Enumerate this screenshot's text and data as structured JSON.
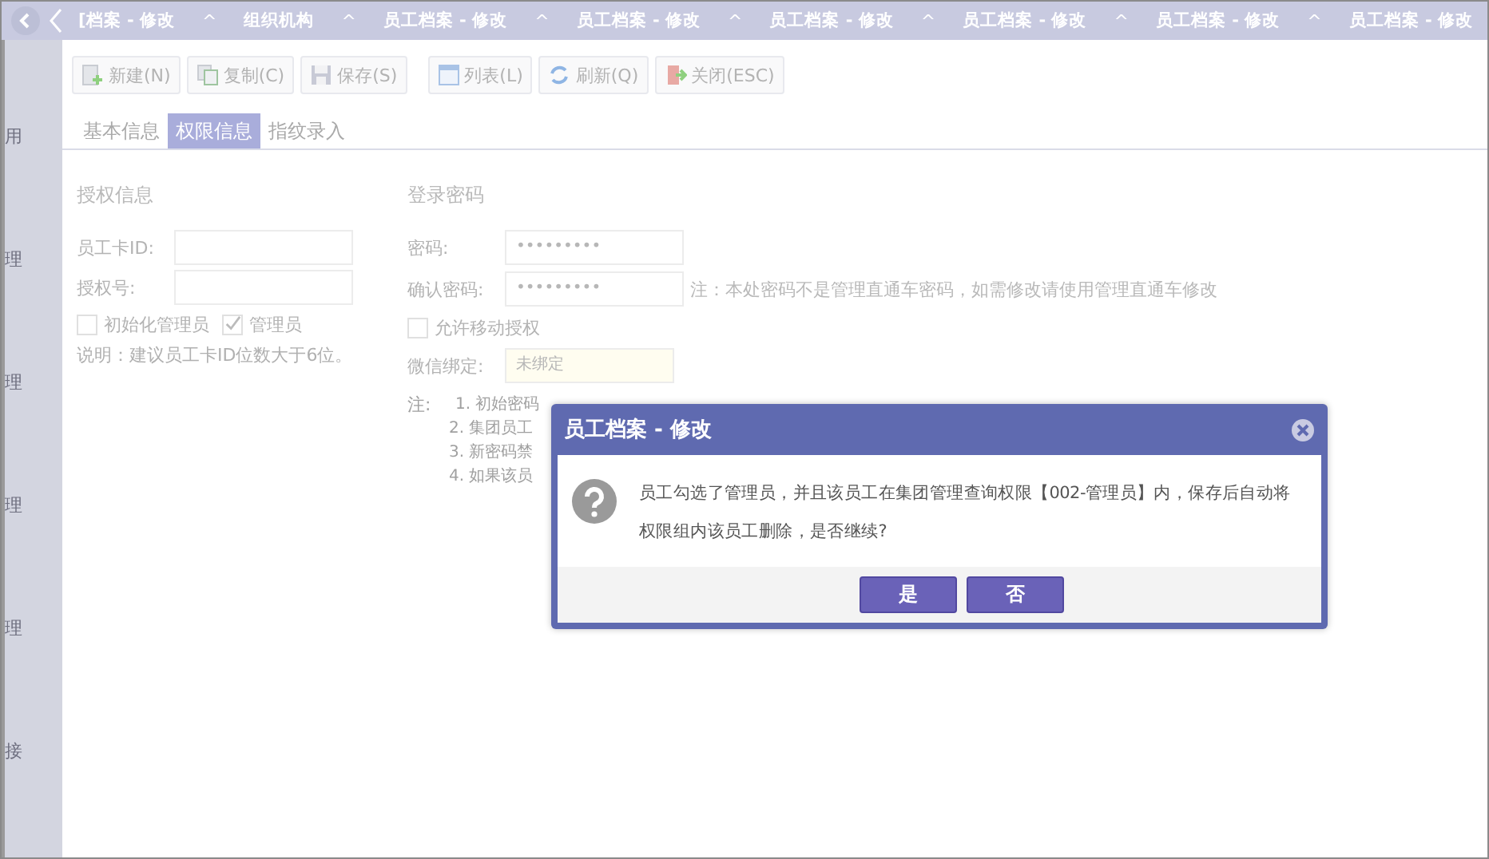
{
  "tabs": [
    {
      "label": "[档案 - 修改",
      "marker": "^"
    },
    {
      "label": "组织机构",
      "marker": "^"
    },
    {
      "label": "员工档案 - 修改",
      "marker": "^"
    },
    {
      "label": "员工档案 - 修改",
      "marker": "^"
    },
    {
      "label": "员工档案 - 修改",
      "marker": "^"
    },
    {
      "label": "员工档案 - 修改",
      "marker": "^"
    },
    {
      "label": "员工档案 - 修改",
      "marker": "^"
    },
    {
      "label": "员工档案 - 修改"
    }
  ],
  "sidebar": {
    "items": [
      "用",
      "理",
      "理",
      "理",
      "理",
      "接"
    ]
  },
  "toolbar": [
    {
      "label": "新建(N)",
      "kind": "new"
    },
    {
      "label": "复制(C)",
      "kind": "copy"
    },
    {
      "label": "保存(S)",
      "kind": "save"
    },
    {
      "label": "列表(L)",
      "kind": "list"
    },
    {
      "label": "刷新(Q)",
      "kind": "refresh"
    },
    {
      "label": "关闭(ESC)",
      "kind": "close"
    }
  ],
  "subtabs": [
    {
      "label": "基本信息",
      "selected": false
    },
    {
      "label": "权限信息",
      "selected": true
    },
    {
      "label": "指纹录入",
      "selected": false
    }
  ],
  "auth": {
    "title": "授权信息",
    "fields": [
      {
        "label": "员工卡ID:"
      },
      {
        "label": "授权号:"
      }
    ],
    "checkboxes": [
      {
        "label": "初始化管理员",
        "checked": false
      },
      {
        "label": "管理员",
        "checked": true
      }
    ],
    "hint": "说明：建议员工卡ID位数大于6位。"
  },
  "login": {
    "title": "登录密码",
    "fields": [
      {
        "label": "密码:",
        "value": "•••••••••"
      },
      {
        "label": "确认密码:",
        "value": "•••••••••"
      }
    ],
    "note": "注：本处密码不是管理直通车密码，如需修改请使用管理直通车修改",
    "checkbox": {
      "label": "允许移动授权",
      "checked": false
    },
    "wechat": {
      "label": "微信绑定:",
      "value": "未绑定"
    },
    "notes_label": "注:",
    "notes": [
      "1. 初始密码",
      "2. 集团员工",
      "3. 新密码禁",
      "4. 如果该员"
    ]
  },
  "dialog": {
    "title": "员工档案 - 修改",
    "message": "员工勾选了管理员，并且该员工在集团管理查询权限【002-管理员】内，保存后自动将权限组内该员工删除，是否继续?",
    "buttons": [
      "是",
      "否"
    ]
  }
}
